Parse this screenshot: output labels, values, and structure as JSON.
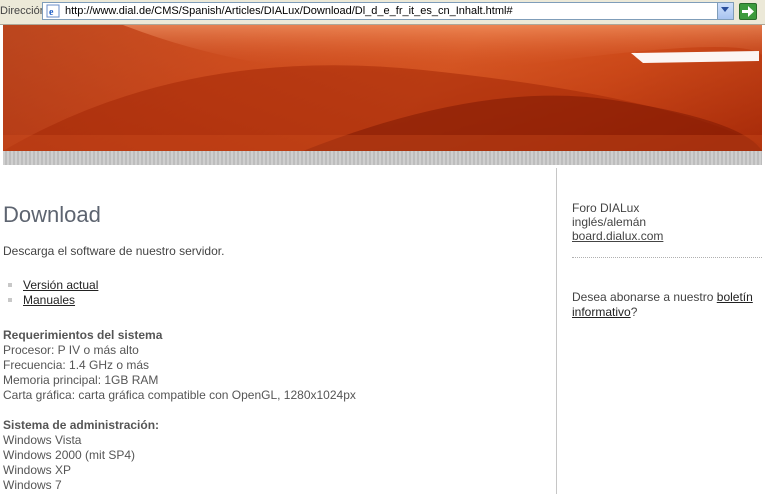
{
  "browser": {
    "address_label": "Dirección",
    "url": "http://www.dial.de/CMS/Spanish/Articles/DIALux/Download/Dl_d_e_fr_it_es_cn_Inhalt.html#"
  },
  "main": {
    "title": "Download",
    "intro": "Descarga el software de nuestro servidor.",
    "links": [
      "Versión actual",
      "Manuales"
    ],
    "requirements": {
      "heading": "Requerimientos del sistema",
      "lines": [
        "Procesor: P IV o más alto",
        "Frecuencia: 1.4 GHz o más",
        "Memoria principal: 1GB RAM",
        "Carta gráfica: carta gráfica compatible con OpenGL, 1280x1024px"
      ]
    },
    "admin": {
      "heading": "Sistema de administración:",
      "lines": [
        "Windows Vista",
        "Windows 2000 (mit SP4)",
        "Windows XP",
        "Windows 7"
      ]
    }
  },
  "sidebar": {
    "forum_title": "Foro DIALux",
    "forum_lang": "inglés/alemán",
    "forum_link": "board.dialux.com",
    "subscribe_text": "Desea abonarse a nuestro ",
    "subscribe_link": "boletín informativo",
    "subscribe_end": "?"
  },
  "colors": {
    "banner": "#d84a15",
    "go_button": "#3c9a3c",
    "title": "#5d6470"
  }
}
